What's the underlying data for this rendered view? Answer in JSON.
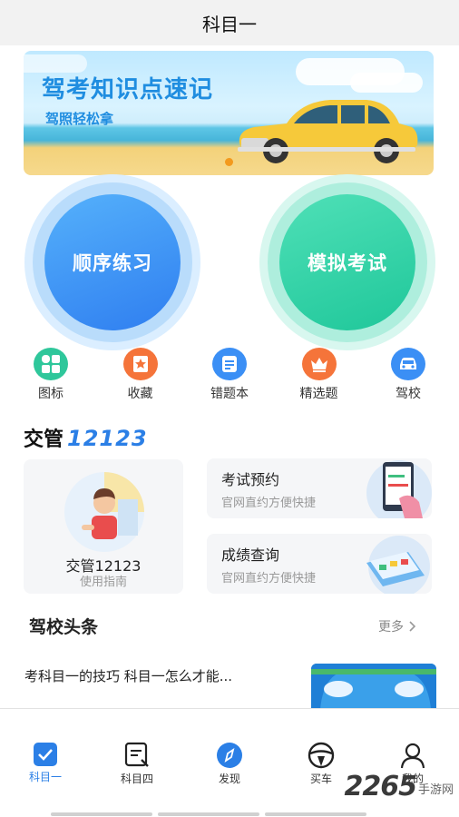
{
  "header": {
    "title": "科目一"
  },
  "banner": {
    "title": "驾考知识点速记",
    "subtitle": "驾照轻松拿"
  },
  "main_actions": [
    {
      "label": "顺序练习",
      "color": "#3b8ff5"
    },
    {
      "label": "模拟考试",
      "color": "#27cfa1"
    }
  ],
  "quick_links": [
    {
      "label": "图标",
      "icon": "grid-icon",
      "color": "#2fc79b"
    },
    {
      "label": "收藏",
      "icon": "star-bookmark-icon",
      "color": "#f5743a"
    },
    {
      "label": "错题本",
      "icon": "document-icon",
      "color": "#3b8ff5"
    },
    {
      "label": "精选题",
      "icon": "crown-icon",
      "color": "#f5743a"
    },
    {
      "label": "驾校",
      "icon": "car-icon",
      "color": "#3b8ff5"
    }
  ],
  "jiaoguan": {
    "title_text": "交管",
    "title_number": "12123",
    "guide": {
      "name": "交管12123",
      "subtitle": "使用指南"
    },
    "services": [
      {
        "title": "考试预约",
        "subtitle": "官网直约方便快捷"
      },
      {
        "title": "成绩查询",
        "subtitle": "官网直约方便快捷"
      }
    ]
  },
  "news": {
    "heading": "驾校头条",
    "more_label": "更多",
    "items": [
      {
        "title": "考科目一的技巧 科目一怎么才能..."
      }
    ]
  },
  "tabbar": {
    "tabs": [
      {
        "label": "科目一",
        "icon": "check-square-icon",
        "active": true
      },
      {
        "label": "科目四",
        "icon": "search-document-icon",
        "active": false
      },
      {
        "label": "发现",
        "icon": "compass-icon",
        "active": false
      },
      {
        "label": "买车",
        "icon": "steering-wheel-icon",
        "active": false
      },
      {
        "label": "我的",
        "icon": "user-icon",
        "active": false
      }
    ]
  },
  "watermark": {
    "number": "2265",
    "text": "手游网"
  },
  "colors": {
    "accent": "#2b7fe6",
    "green": "#27cfa1",
    "orange": "#f5743a"
  }
}
